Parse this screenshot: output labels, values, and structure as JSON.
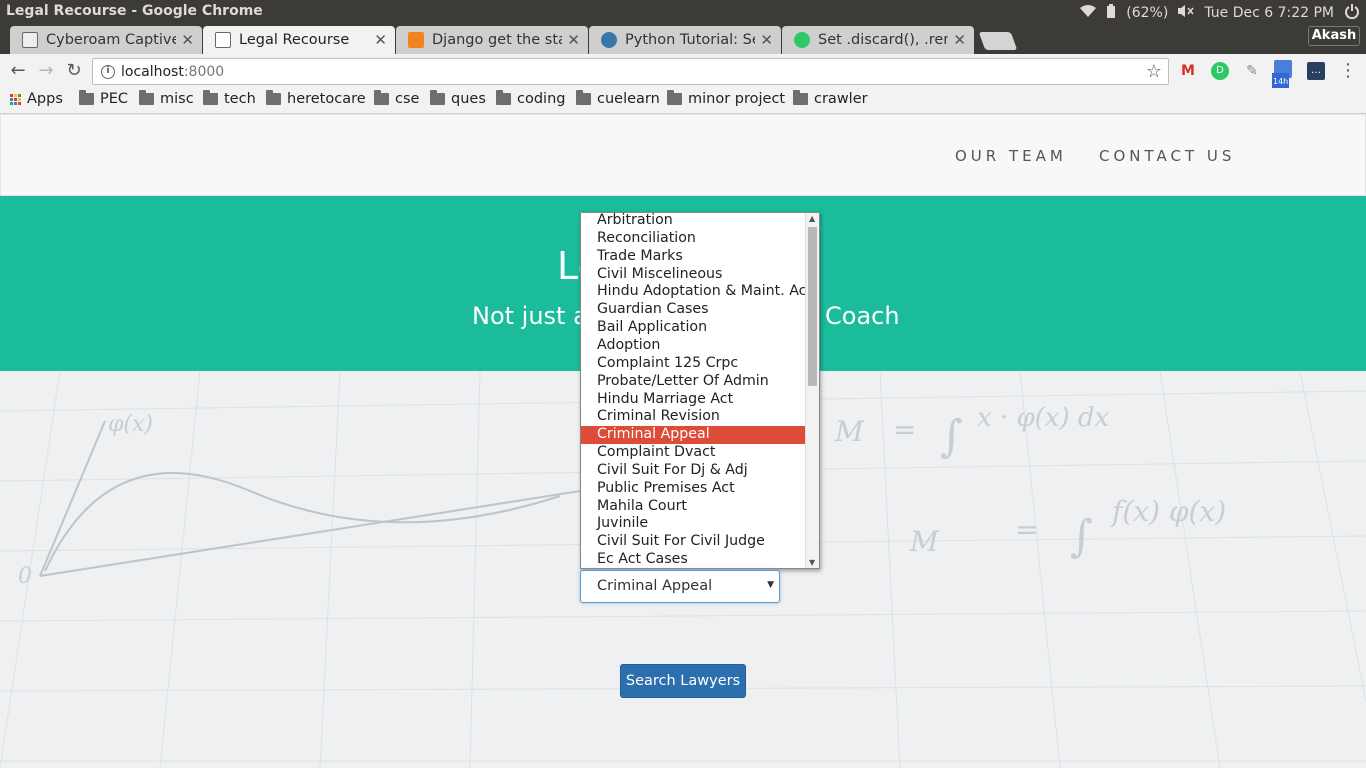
{
  "os": {
    "window_title": "Legal Recourse - Google Chrome",
    "battery": "(62%)",
    "clock": "Tue Dec  6  7:22 PM"
  },
  "browser": {
    "tabs": [
      {
        "title": "Cyberoam Captive Portal",
        "active": false,
        "icon": "page-icon"
      },
      {
        "title": "Legal Recourse",
        "active": true,
        "icon": "page-icon"
      },
      {
        "title": "Django get the static files",
        "active": false,
        "icon": "stackoverflow-icon"
      },
      {
        "title": "Python Tutorial: Sets",
        "active": false,
        "icon": "python-icon"
      },
      {
        "title": "Set .discard(), .remove()",
        "active": false,
        "icon": "hackerrank-icon"
      }
    ],
    "profile_name": "Akash",
    "url_host": "localhost",
    "url_port": ":8000",
    "ext_badge": "14h",
    "bookmarks": [
      "Apps",
      "PEC",
      "misc",
      "tech",
      "heretocare",
      "cse",
      "ques",
      "coding",
      "cuelearn",
      "minor project",
      "crawler"
    ]
  },
  "site": {
    "nav_links": [
      "OUR TEAM",
      "CONTACT US"
    ],
    "hero_title": "Le",
    "hero_sub_left": "Not just a",
    "hero_sub_right": "Coach",
    "select": {
      "selected": "Criminal Appeal",
      "options": [
        "Arbitration",
        "Reconciliation",
        "Trade Marks",
        "Civil Miscelineous",
        "Hindu Adoptation & Maint. Act",
        "Guardian Cases",
        "Bail Application",
        "Adoption",
        "Complaint 125 Crpc",
        "Probate/Letter Of Admin",
        "Hindu Marriage Act",
        "Criminal Revision",
        "Criminal Appeal",
        "Complaint Dvact",
        "Civil Suit For Dj & Adj",
        "Public Premises Act",
        "Mahila Court",
        "Juvinile",
        "Civil Suit For Civil Judge",
        "Ec Act Cases"
      ]
    },
    "search_button": "Search Lawyers"
  },
  "colors": {
    "hero_bg": "#1abc9c",
    "selected_option": "#dd4b39",
    "button": "#2d6fae"
  }
}
